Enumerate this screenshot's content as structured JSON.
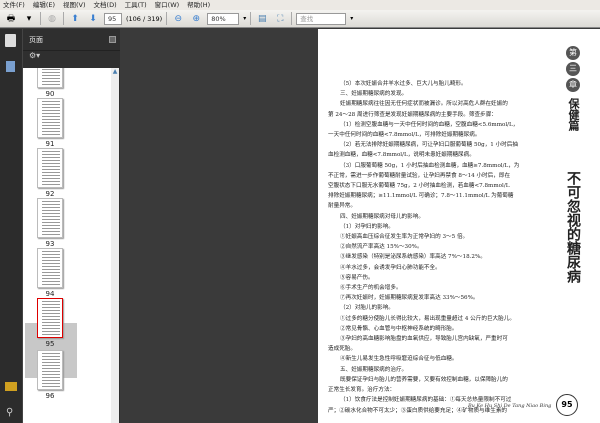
{
  "menu": [
    "文件(F)",
    "编辑(E)",
    "视图(V)",
    "文档(D)",
    "工具(T)",
    "窗口(W)",
    "帮助(H)"
  ],
  "toolbar": {
    "page_input": "95",
    "page_count": "(106 / 319)",
    "zoom": "80%",
    "search_placeholder": "查找"
  },
  "panel": {
    "title": "页面",
    "thumbnails": [
      "90",
      "91",
      "92",
      "93",
      "94",
      "95",
      "96"
    ],
    "selected": "95"
  },
  "page": {
    "lines": [
      {
        "t": "（5）本次妊娠合并羊水过多、巨大儿与胎儿畸形。",
        "i": 1
      },
      {
        "t": "三、妊娠期糖尿病的发现。",
        "i": 1
      },
      {
        "t": "妊娠期糖尿病往往因无任何症状而被漏诊。所以对高危人群在妊娠的",
        "i": 1
      },
      {
        "t": "第 24～28 周进行筛查是发现妊娠期糖尿病的主要手段。筛查步骤：",
        "i": 0
      },
      {
        "t": "（1）检测空腹血糖与一天中任何时间的血糖，空腹血糖<5.6mmol/L，",
        "i": 1
      },
      {
        "t": "一天中任何时间的血糖<7.8mmol/L，可排除妊娠期糖尿病。",
        "i": 0
      },
      {
        "t": "（2）若无法排除妊娠期糖尿病，可让孕妇口服葡萄糖 50g，1 小时后抽",
        "i": 1
      },
      {
        "t": "血检测血糖，血糖<7.8mmol/L，说明未患妊娠期糖尿病。",
        "i": 0
      },
      {
        "t": "（3）口服葡萄糖 50g，1 小时后抽血检测血糖，血糖≥7.8mmol/L，为",
        "i": 1
      },
      {
        "t": "不正常，需进一步作葡萄糖耐量试验，让孕妇再禁食 8～14 小时后，即在",
        "i": 0
      },
      {
        "t": "空腹状态下口服无水葡萄糖 75g，2 小时抽血检测，若血糖<7.8mmol/L",
        "i": 0
      },
      {
        "t": "排除妊娠期糖尿病；≥11.1mmol/L 可确诊；7.8～11.1mmol/L 为葡萄糖",
        "i": 0
      },
      {
        "t": "耐量异常。",
        "i": 0
      },
      {
        "t": "四、妊娠期糖尿病对母儿的影响。",
        "i": 1
      },
      {
        "t": "（1）对孕妇的影响。",
        "i": 1
      },
      {
        "t": "①妊娠高血压综合征发生率为正常孕妇的 3～5 倍。",
        "i": 1
      },
      {
        "t": "②自然流产率高达 15%～30%。",
        "i": 1
      },
      {
        "t": "③继发感染（特别是泌尿系统感染）率高达 7%～18.2%。",
        "i": 1
      },
      {
        "t": "④羊水过多，会诱发孕妇心肺功能不全。",
        "i": 1
      },
      {
        "t": "⑤容易产伤。",
        "i": 1
      },
      {
        "t": "⑥手术生产的机会增多。",
        "i": 1
      },
      {
        "t": "⑦再次妊娠时，妊娠期糖尿病复发率高达 33%～56%。",
        "i": 1
      },
      {
        "t": "（2）对胎儿的影响。",
        "i": 1
      },
      {
        "t": "①过多的糖分使胎儿长得比较大，易出现重量超过 4 公斤的巨大胎儿。",
        "i": 1
      },
      {
        "t": "②常见骨骼、心血管与中枢神经系统的畸形胎。",
        "i": 1
      },
      {
        "t": "③孕妇的高血糖影响胎盘的血氧供应，导致胎儿宫内缺氧，严重时可",
        "i": 1
      },
      {
        "t": "造成死胎。",
        "i": 0
      },
      {
        "t": "④新生儿易发生急性呼吸窘迫综合征与低血糖。",
        "i": 1
      },
      {
        "t": "五、妊娠期糖尿病的治疗。",
        "i": 1
      },
      {
        "t": "既要保证孕妇与胎儿的营养需要，又要有效控制血糖，以保障胎儿的",
        "i": 1
      },
      {
        "t": "正常生长发育。治疗方法：",
        "i": 0
      },
      {
        "t": "（1）饮食疗法是控制妊娠期糖尿病的基础：①每天总热量限制不可过",
        "i": 1
      },
      {
        "t": "严；②碳水化合物不可太少；③蛋白质供给要充足；④矿物质与维生素的",
        "i": 0
      }
    ],
    "chapter": [
      "第",
      "三",
      "章"
    ],
    "section": "保健篇",
    "book_title": "不可忽视的糖尿病",
    "footer": "Bu Ke Hu Shi De Tang Niao Bing",
    "page_number": "95"
  }
}
